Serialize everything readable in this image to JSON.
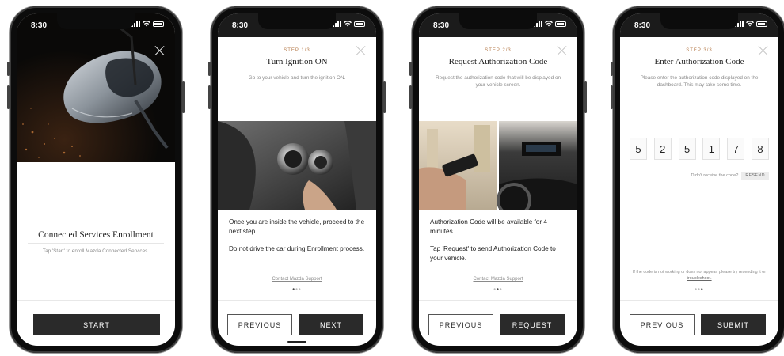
{
  "status_time": "8:30",
  "screens": [
    {
      "title": "Connected Services Enrollment",
      "subtitle": "Tap 'Start' to enroll Mazda Connected Services.",
      "primary_button": "START"
    },
    {
      "step": "STEP 1/3",
      "title": "Turn Ignition ON",
      "subtitle": "Go to your vehicle and turn the ignition ON.",
      "body": [
        "Once you are inside the vehicle, proceed to the next step.",
        "Do not drive the car during Enrollment process."
      ],
      "support_link": "Contact Mazda Support",
      "secondary_button": "PREVIOUS",
      "primary_button": "NEXT",
      "page_index": 1
    },
    {
      "step": "STEP 2/3",
      "title": "Request Authorization Code",
      "subtitle": "Request the authorization code that will be displayed on your vehicle screen.",
      "body": [
        "Authorization Code will be available for 4 minutes.",
        "Tap 'Request' to send Authorization Code to your vehicle."
      ],
      "support_link": "Contact Mazda Support",
      "secondary_button": "PREVIOUS",
      "primary_button": "REQUEST",
      "page_index": 2
    },
    {
      "step": "STEP 3/3",
      "title": "Enter Authorization Code",
      "subtitle": "Please enter the authorization code displayed on the dashboard. This may take some time.",
      "code_digits": [
        "5",
        "2",
        "5",
        "1",
        "7",
        "8"
      ],
      "resend_prompt": "Didn't receive the code?",
      "resend_button": "RESEND",
      "help_text": "If the code is not working or does not appear, please try resending it or",
      "help_link": "troubleshoot.",
      "secondary_button": "PREVIOUS",
      "primary_button": "SUBMIT",
      "page_index": 3
    }
  ],
  "colors": {
    "accent": "#b57a4a",
    "button_dark": "#2a2a2a",
    "muted_text": "#8a8a8a"
  }
}
